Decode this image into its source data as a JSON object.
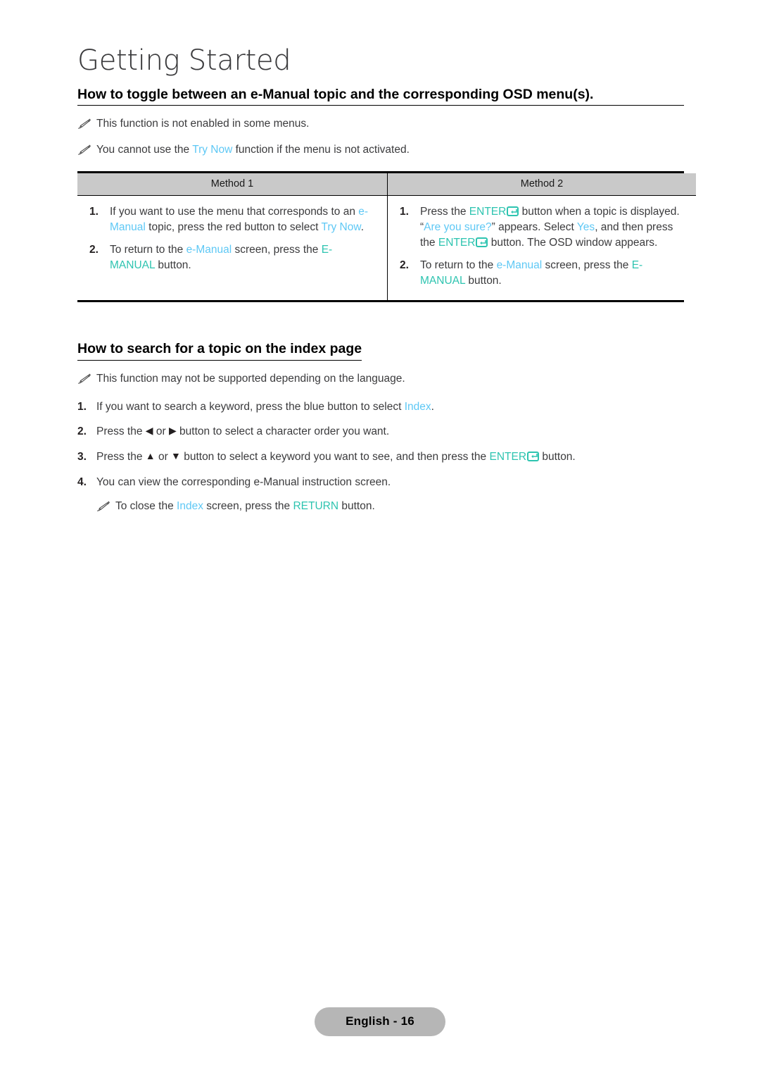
{
  "chapter": {
    "title": "Getting Started"
  },
  "section1": {
    "heading": "How to toggle between an e-Manual topic and the corresponding OSD menu(s).",
    "notes": [
      {
        "before": "This function is not enabled in some menus.",
        "accent": "",
        "after": ""
      },
      {
        "before": "You cannot use the ",
        "accent": "Try Now",
        "after": " function if the menu is not activated."
      }
    ],
    "table": {
      "headers": [
        "Method 1",
        "Method 2"
      ],
      "method1": [
        {
          "num": "1.",
          "parts": [
            {
              "text": "If you want to use the menu that corresponds to an ",
              "style": "plain"
            },
            {
              "text": "e-Manual",
              "style": "blue"
            },
            {
              "text": " topic, press the red button to select ",
              "style": "plain"
            },
            {
              "text": "Try Now",
              "style": "blue"
            },
            {
              "text": ".",
              "style": "plain"
            }
          ]
        },
        {
          "num": "2.",
          "parts": [
            {
              "text": "To return to the ",
              "style": "plain"
            },
            {
              "text": "e-Manual",
              "style": "blue"
            },
            {
              "text": " screen, press the ",
              "style": "plain"
            },
            {
              "text": "E-MANUAL",
              "style": "teal"
            },
            {
              "text": " button.",
              "style": "plain"
            }
          ]
        }
      ],
      "method2": [
        {
          "num": "1.",
          "parts": [
            {
              "text": "Press the ",
              "style": "plain"
            },
            {
              "text": "ENTER",
              "style": "teal"
            },
            {
              "text": "",
              "style": "enter-key"
            },
            {
              "text": " button when a topic is displayed. ",
              "style": "plain"
            },
            {
              "text": "“",
              "style": "plain"
            },
            {
              "text": "Are you sure?",
              "style": "blue"
            },
            {
              "text": "”",
              "style": "plain"
            },
            {
              "text": " appears. Select ",
              "style": "plain"
            },
            {
              "text": "Yes",
              "style": "blue"
            },
            {
              "text": ", and then press the ",
              "style": "plain"
            },
            {
              "text": "ENTER",
              "style": "teal"
            },
            {
              "text": "",
              "style": "enter-key"
            },
            {
              "text": " button. The OSD window appears.",
              "style": "plain"
            }
          ]
        },
        {
          "num": "2.",
          "parts": [
            {
              "text": "To return to the ",
              "style": "plain"
            },
            {
              "text": "e-Manual",
              "style": "blue"
            },
            {
              "text": " screen, press the ",
              "style": "plain"
            },
            {
              "text": "E-MANUAL",
              "style": "teal"
            },
            {
              "text": " button.",
              "style": "plain"
            }
          ]
        }
      ]
    }
  },
  "section2": {
    "heading": "How to search for a topic on the index page",
    "note": {
      "before": "This function may not be supported depending on the language.",
      "accent": "",
      "after": ""
    },
    "steps": [
      {
        "num": "1.",
        "parts": [
          {
            "text": "If you want to search a keyword, press the blue button to select ",
            "style": "plain"
          },
          {
            "text": "Index",
            "style": "blue"
          },
          {
            "text": ".",
            "style": "plain"
          }
        ]
      },
      {
        "num": "2.",
        "parts": [
          {
            "text": "Press the ",
            "style": "plain"
          },
          {
            "text": "◀",
            "style": "arrow"
          },
          {
            "text": " or ",
            "style": "plain"
          },
          {
            "text": "▶",
            "style": "arrow"
          },
          {
            "text": " button to select a character order you want.",
            "style": "plain"
          }
        ]
      },
      {
        "num": "3.",
        "parts": [
          {
            "text": "Press the ",
            "style": "plain"
          },
          {
            "text": "▲",
            "style": "arrow"
          },
          {
            "text": " or ",
            "style": "plain"
          },
          {
            "text": "▼",
            "style": "arrow"
          },
          {
            "text": " button to select a keyword you want to see, and then press the ",
            "style": "plain"
          },
          {
            "text": "ENTER",
            "style": "teal"
          },
          {
            "text": "",
            "style": "enter-key"
          },
          {
            "text": " button.",
            "style": "plain"
          }
        ]
      },
      {
        "num": "4.",
        "parts": [
          {
            "text": "You can view the corresponding e-Manual instruction screen.",
            "style": "plain"
          }
        ]
      }
    ],
    "subnote": {
      "parts": [
        {
          "text": "To close the ",
          "style": "plain"
        },
        {
          "text": "Index",
          "style": "blue"
        },
        {
          "text": " screen, press the ",
          "style": "plain"
        },
        {
          "text": "RETURN",
          "style": "teal"
        },
        {
          "text": " button.",
          "style": "plain"
        }
      ]
    }
  },
  "footer": {
    "page_label": "English - 16"
  },
  "colors": {
    "blue": "#5ec8f5",
    "teal": "#2ec4b0",
    "header_bg": "#c9c9c9",
    "badge_bg": "#b6b6b6"
  }
}
